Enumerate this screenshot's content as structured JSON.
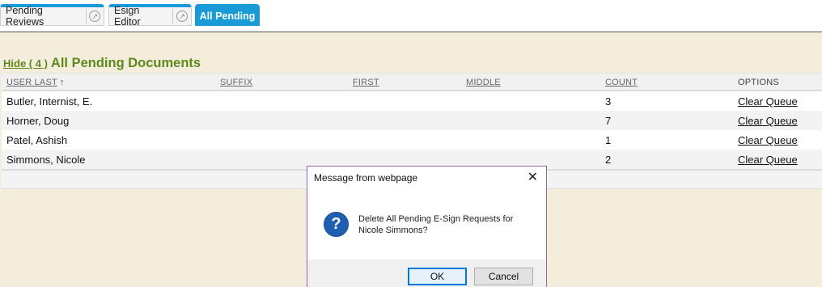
{
  "tabs": [
    {
      "label": "Pending Reviews",
      "has_popout": true
    },
    {
      "label": "Esign Editor",
      "has_popout": true
    },
    {
      "label": "All Pending",
      "active": true
    }
  ],
  "section": {
    "hide_label": "Hide ( 4 )",
    "title": "All Pending Documents"
  },
  "table": {
    "columns": [
      "USER LAST",
      "SUFFIX",
      "FIRST",
      "MIDDLE",
      "COUNT",
      "OPTIONS"
    ],
    "sort_indicator": "↑",
    "rows": [
      {
        "user_last": "Butler, Internist, E.",
        "suffix": "",
        "first": "",
        "middle": "",
        "count": "3",
        "option": "Clear Queue"
      },
      {
        "user_last": "Horner, Doug",
        "suffix": "",
        "first": "",
        "middle": "",
        "count": "7",
        "option": "Clear Queue"
      },
      {
        "user_last": "Patel, Ashish",
        "suffix": "",
        "first": "",
        "middle": "",
        "count": "1",
        "option": "Clear Queue"
      },
      {
        "user_last": "Simmons, Nicole",
        "suffix": "",
        "first": "",
        "middle": "",
        "count": "2",
        "option": "Clear Queue"
      }
    ]
  },
  "dialog": {
    "title": "Message from webpage",
    "close_glyph": "✕",
    "icon_glyph": "?",
    "message": "Delete All Pending E-Sign Requests for Nicole Simmons?",
    "ok_label": "OK",
    "cancel_label": "Cancel"
  },
  "colors": {
    "tab_accent": "#1a9ad6",
    "section_green": "#5e8a1c",
    "page_background": "#f5eddc",
    "dialog_border": "#8e6aa8",
    "question_icon_blue": "#1e5fb3"
  }
}
